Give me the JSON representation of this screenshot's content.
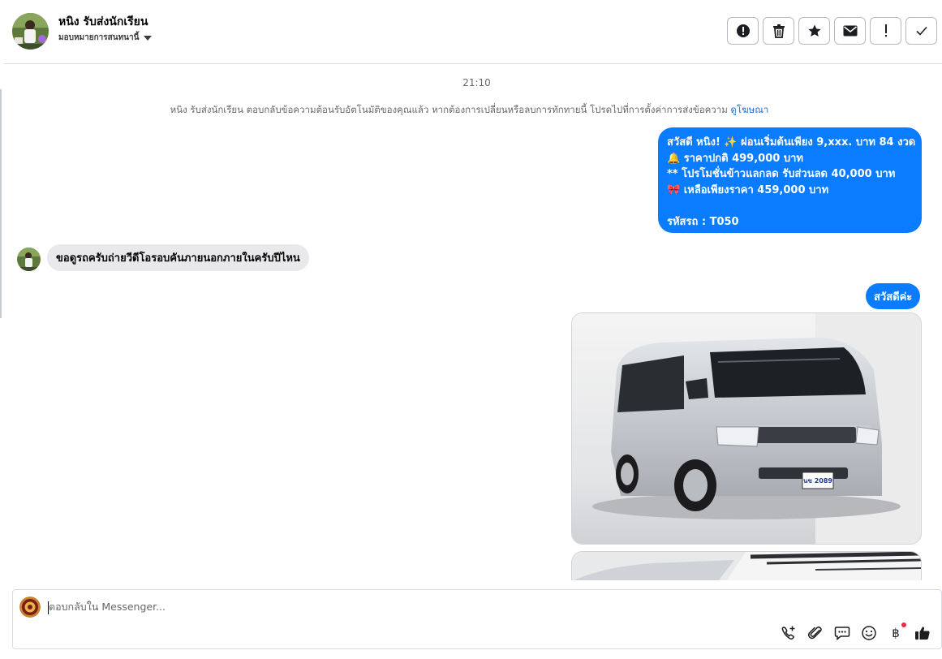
{
  "header": {
    "contact_name": "หนิง รับส่งนักเรียน",
    "assign_label": "มอบหมายการสนทนานี้",
    "toolbar": [
      {
        "icon": "report-spam-icon",
        "title": "spam"
      },
      {
        "icon": "trash-icon",
        "title": "delete"
      },
      {
        "icon": "star-icon",
        "title": "star"
      },
      {
        "icon": "envelope-icon",
        "title": "unread"
      },
      {
        "icon": "exclamation-icon",
        "title": "follow up"
      },
      {
        "icon": "checkmark-icon",
        "title": "done"
      }
    ]
  },
  "thread": {
    "timestamp": "21:10",
    "notice_text": "หนิง รับส่งนักเรียน ตอบกลับข้อความต้อนรับอัตโนมัติของคุณแล้ว หากต้องการเปลี่ยนหรือลบการทักทายนี้ โปรดไปที่การตั้งค่าการส่งข้อความ",
    "notice_link": "ดูโฆษณา",
    "promo_message": {
      "lines": [
        "สวัสดี หนิง! ✨  ผ่อนเริ่มต้นเพียง 9,xxx. บาท 84 งวด",
        "🔔 ราคาปกติ 499,000 บาท",
        "** โปรโมชั่นข้าวแลกลด รับส่วนลด 40,000 บาท",
        "🎀  เหลือเพียงราคา 459,000 บาท",
        "",
        "รหัสรถ : T050"
      ]
    },
    "incoming_message": "ขอดูรถครับถ่ายวีดีโอรอบคันภายนอกภายในครับปีไหน",
    "reply_message": "สวัสดีค่ะ",
    "photo_plate": "นข 2089"
  },
  "composer": {
    "placeholder": "ตอบกลับใน Messenger...",
    "actions": [
      "add-call-icon",
      "attach-icon",
      "saved-replies-icon",
      "emoji-icon",
      "payment-icon",
      "like-icon"
    ]
  },
  "colors": {
    "accent": "#0a7cff",
    "incoming_bubble": "#e9e9eb",
    "link": "#216fdb",
    "notification_dot": "#f02849"
  }
}
